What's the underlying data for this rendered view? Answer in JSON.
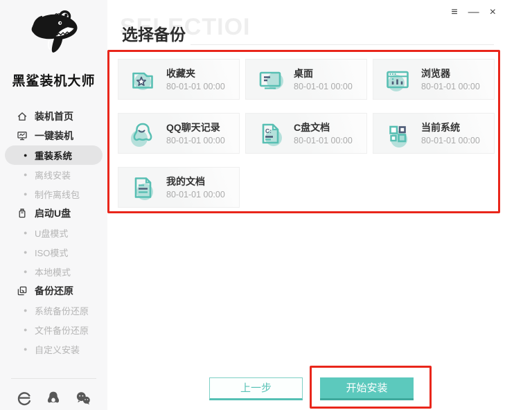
{
  "brand": {
    "name": "黑鲨装机大师"
  },
  "window": {
    "menu_glyph": "≡",
    "minimize_glyph": "—",
    "close_glyph": "×"
  },
  "sidebar": {
    "items": [
      {
        "label": "装机首页",
        "type": "section",
        "icon": "home-icon",
        "active": false
      },
      {
        "label": "一键装机",
        "type": "section",
        "icon": "monitor-chart-icon",
        "active": false
      },
      {
        "label": "重装系统",
        "type": "sub",
        "active": true
      },
      {
        "label": "离线安装",
        "type": "sub",
        "active": false
      },
      {
        "label": "制作离线包",
        "type": "sub",
        "active": false
      },
      {
        "label": "启动U盘",
        "type": "section",
        "icon": "usb-drive-icon",
        "active": false
      },
      {
        "label": "U盘模式",
        "type": "sub",
        "active": false
      },
      {
        "label": "ISO模式",
        "type": "sub",
        "active": false
      },
      {
        "label": "本地模式",
        "type": "sub",
        "active": false
      },
      {
        "label": "备份还原",
        "type": "section",
        "icon": "backup-restore-icon",
        "active": false
      },
      {
        "label": "系统备份还原",
        "type": "sub",
        "active": false
      },
      {
        "label": "文件备份还原",
        "type": "sub",
        "active": false
      },
      {
        "label": "自定义安装",
        "type": "sub",
        "active": false
      }
    ],
    "footer_icons": [
      {
        "name": "ie-browser-icon"
      },
      {
        "name": "qq-icon"
      },
      {
        "name": "wechat-icon"
      }
    ]
  },
  "main": {
    "watermark": "SELECTIOI",
    "title": "选择备份",
    "cards": [
      {
        "label": "收藏夹",
        "date": "80-01-01 00:00",
        "icon": "favorites-folder-icon"
      },
      {
        "label": "桌面",
        "date": "80-01-01 00:00",
        "icon": "desktop-icon"
      },
      {
        "label": "浏览器",
        "date": "80-01-01 00:00",
        "icon": "browser-icon"
      },
      {
        "label": "QQ聊天记录",
        "date": "80-01-01 00:00",
        "icon": "qq-chat-icon"
      },
      {
        "label": "C盘文档",
        "date": "80-01-01 00:00",
        "icon": "c-drive-doc-icon"
      },
      {
        "label": "当前系统",
        "date": "80-01-01 00:00",
        "icon": "current-system-icon"
      },
      {
        "label": "我的文档",
        "date": "80-01-01 00:00",
        "icon": "my-documents-icon"
      }
    ],
    "buttons": {
      "previous": "上一步",
      "start": "开始安装"
    }
  },
  "colors": {
    "teal": "#5ac3b7",
    "teal_dark": "#3fa99c",
    "navy": "#4c5b76",
    "highlight_red": "#e9261b",
    "active_pill": "#e4e4e5",
    "sidebar_bg": "#f7f7f8"
  }
}
